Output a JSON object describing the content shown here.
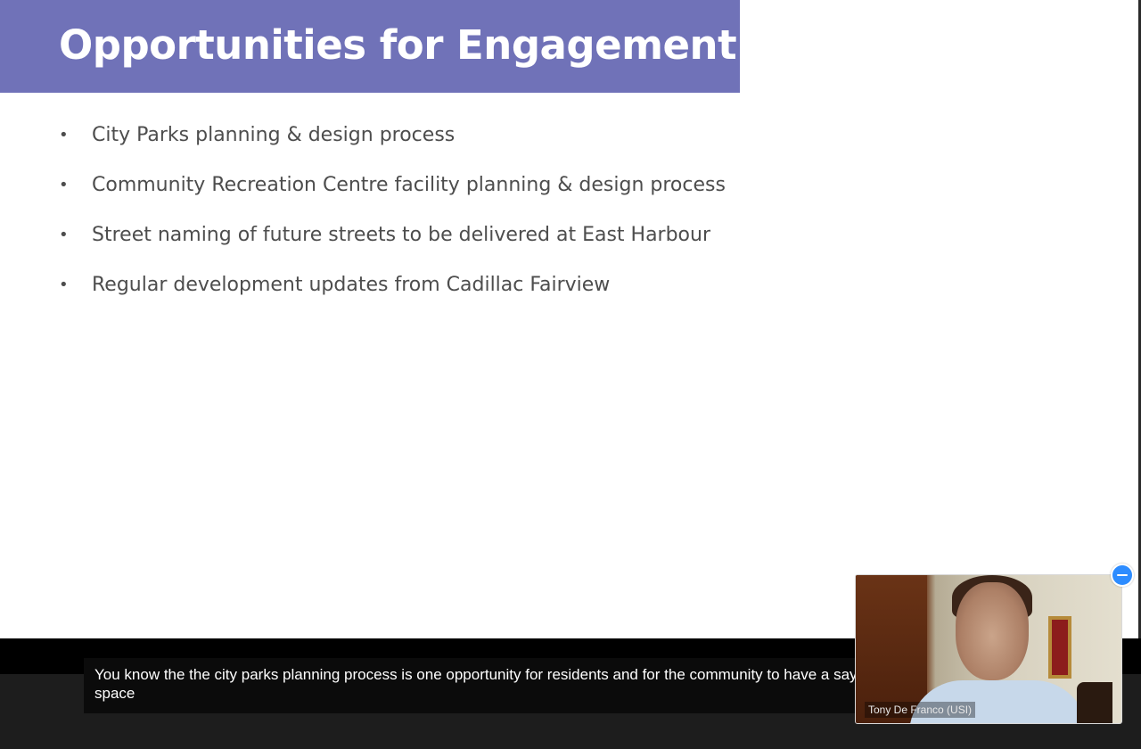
{
  "slide": {
    "title": "Opportunities for Engagement",
    "bullet_glyph": "•",
    "bullets": [
      "City Parks planning & design process",
      "Community Recreation Centre facility planning & design process",
      "Street naming of future streets to be delivered at East Harbour",
      "Regular development updates from Cadillac Fairview"
    ]
  },
  "caption": {
    "text": "You know the the city parks planning process is one opportunity for residents and for the community to have a say, and how the the parks space"
  },
  "video": {
    "participant_name": "Tony De Franco (USI)",
    "minimize_icon": "minus-circle-icon"
  },
  "colors": {
    "title_banner": "#7072b8",
    "bullet_text": "#4d4d4d",
    "caption_bg": "#0b0b0b",
    "accent": "#2d8cff"
  }
}
